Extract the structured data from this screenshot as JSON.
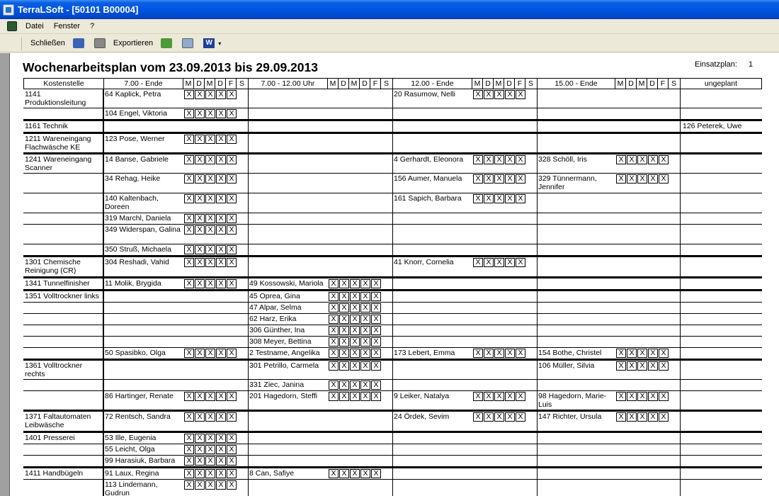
{
  "window": {
    "title": "TerraLSoft - [50101 B00004]"
  },
  "menu": {
    "items": [
      "Datei",
      "Fenster",
      "?"
    ]
  },
  "toolbar": {
    "close_label": "Schließen",
    "export_label": "Exportieren",
    "word_glyph": "W"
  },
  "report": {
    "title": "Wochenarbeitsplan vom 23.09.2013 bis 29.09.2013",
    "einsatz_label": "Einsatzplan:",
    "einsatz_value": "1",
    "headers": {
      "kostenstelle": "Kostenstelle",
      "shift1": "7.00 - Ende",
      "shift2": "7.00 - 12.00 Uhr",
      "shift3": "12.00 - Ende",
      "shift4": "15.00 - Ende",
      "ungeplant": "ungeplant",
      "days": [
        "M",
        "D",
        "M",
        "D",
        "F",
        "S"
      ]
    },
    "rows": [
      {
        "k": "1141 Produktionsleitung",
        "s1": "64 Kaplick, Petra",
        "d1": 5,
        "s2": "",
        "d2": 0,
        "s3": "20 Rasumow, Nelli",
        "d3": 5,
        "s4": "",
        "d4": 0,
        "u": "",
        "h": 26,
        "end": false
      },
      {
        "k": "",
        "s1": "104 Engel, Viktoria",
        "d1": 5,
        "s2": "",
        "d2": 0,
        "s3": "",
        "d3": 0,
        "s4": "",
        "d4": 0,
        "u": "",
        "h": 15,
        "end": true
      },
      {
        "k": "1161 Technik",
        "s1": "",
        "d1": 0,
        "s2": "",
        "d2": 0,
        "s3": "",
        "d3": 0,
        "s4": "",
        "d4": 0,
        "u": "126 Peterek, Uwe",
        "h": 15,
        "end": true
      },
      {
        "k": "1211 Wareneingang Flachwäsche KE",
        "s1": "123 Pose, Werner",
        "d1": 5,
        "s2": "",
        "d2": 0,
        "s3": "",
        "d3": 0,
        "s4": "",
        "d4": 0,
        "u": "",
        "h": 26,
        "end": true
      },
      {
        "k": "1241 Wareneingang Scanner",
        "s1": "14 Banse, Gabriele",
        "d1": 5,
        "s2": "",
        "d2": 0,
        "s3": "4 Gerhardt, Eleonora",
        "d3": 5,
        "s4": "328 Schöll, Iris",
        "d4": 5,
        "u": "",
        "h": 26,
        "end": false
      },
      {
        "k": "",
        "s1": "34 Rehag, Heike",
        "d1": 5,
        "s2": "",
        "d2": 0,
        "s3": "156 Aumer, Manuela",
        "d3": 5,
        "s4": "329 Tünnermann, Jennifer",
        "d4": 5,
        "u": "",
        "h": 27,
        "end": false
      },
      {
        "k": "",
        "s1": "140 Kaltenbach, Doreen",
        "d1": 5,
        "s2": "",
        "d2": 0,
        "s3": "161 Sapich, Barbara",
        "d3": 5,
        "s4": "",
        "d4": 0,
        "u": "",
        "h": 27,
        "end": false
      },
      {
        "k": "",
        "s1": "319 Marchl, Daniela",
        "d1": 5,
        "s2": "",
        "d2": 0,
        "s3": "",
        "d3": 0,
        "s4": "",
        "d4": 0,
        "u": "",
        "h": 15,
        "end": false
      },
      {
        "k": "",
        "s1": "349 Widerspan, Galina",
        "d1": 5,
        "s2": "",
        "d2": 0,
        "s3": "",
        "d3": 0,
        "s4": "",
        "d4": 0,
        "u": "",
        "h": 27,
        "end": false
      },
      {
        "k": "",
        "s1": "350 Struß, Michaela",
        "d1": 5,
        "s2": "",
        "d2": 0,
        "s3": "",
        "d3": 0,
        "s4": "",
        "d4": 0,
        "u": "",
        "h": 15,
        "end": true
      },
      {
        "k": "1301 Chemische Reinigung (CR)",
        "s1": "304 Reshadi, Vahid",
        "d1": 5,
        "s2": "",
        "d2": 0,
        "s3": "41 Knorr, Cornelia",
        "d3": 5,
        "s4": "",
        "d4": 0,
        "u": "",
        "h": 27,
        "end": true
      },
      {
        "k": "1341 Tunnelfinisher",
        "s1": "11 Molik, Brygida",
        "d1": 5,
        "s2": "49 Kossowski, Mariola",
        "d2": 5,
        "s3": "",
        "d3": 0,
        "s4": "",
        "d4": 0,
        "u": "",
        "h": 15,
        "end": true
      },
      {
        "k": "1351 Volltrockner links",
        "s1": "",
        "d1": 0,
        "s2": "45 Oprea, Gina",
        "d2": 5,
        "s3": "",
        "d3": 0,
        "s4": "",
        "d4": 0,
        "u": "",
        "h": 15,
        "end": false
      },
      {
        "k": "",
        "s1": "",
        "d1": 0,
        "s2": "47 Alpar, Selma",
        "d2": 5,
        "s3": "",
        "d3": 0,
        "s4": "",
        "d4": 0,
        "u": "",
        "h": 15,
        "end": false
      },
      {
        "k": "",
        "s1": "",
        "d1": 0,
        "s2": "62 Harz, Erika",
        "d2": 5,
        "s3": "",
        "d3": 0,
        "s4": "",
        "d4": 0,
        "u": "",
        "h": 15,
        "end": false
      },
      {
        "k": "",
        "s1": "",
        "d1": 0,
        "s2": "306 Günther, Ina",
        "d2": 5,
        "s3": "",
        "d3": 0,
        "s4": "",
        "d4": 0,
        "u": "",
        "h": 15,
        "end": false
      },
      {
        "k": "",
        "s1": "",
        "d1": 0,
        "s2": "308 Meyer, Bettina",
        "d2": 5,
        "s3": "",
        "d3": 0,
        "s4": "",
        "d4": 0,
        "u": "",
        "h": 15,
        "end": false
      },
      {
        "k": "",
        "s1": "50 Spasibko, Olga",
        "d1": 5,
        "s2": "2 Testname, Angelika",
        "d2": 5,
        "s3": "173 Lebert, Emma",
        "d3": 5,
        "s4": "154 Bothe, Christel",
        "d4": 5,
        "u": "",
        "h": 15,
        "end": true
      },
      {
        "k": "1361 Volltrockner rechts",
        "s1": "",
        "d1": 0,
        "s2": "301 Petrillo, Carmela",
        "d2": 5,
        "s3": "",
        "d3": 0,
        "s4": "106 Müller, Silvia",
        "d4": 5,
        "u": "",
        "h": 26,
        "end": false
      },
      {
        "k": "",
        "s1": "",
        "d1": 0,
        "s2": "331 Ziec, Janina",
        "d2": 5,
        "s3": "",
        "d3": 0,
        "s4": "",
        "d4": 0,
        "u": "",
        "h": 15,
        "end": false
      },
      {
        "k": "",
        "s1": "86 Hartinger, Renate",
        "d1": 5,
        "s2": "201 Hagedorn, Steffi",
        "d2": 5,
        "s3": "9 Leiker, Natalya",
        "d3": 5,
        "s4": "98 Hagedorn, Marie-Luis",
        "d4": 5,
        "u": "",
        "h": 26,
        "end": true
      },
      {
        "k": "1371 Faltautomaten Leibwäsche",
        "s1": "72 Rentsch, Sandra",
        "d1": 5,
        "s2": "",
        "d2": 0,
        "s3": "24 Ördek, Sevim",
        "d3": 5,
        "s4": "147 Richter, Ursula",
        "d4": 5,
        "u": "",
        "h": 27,
        "end": true
      },
      {
        "k": "1401 Presserei",
        "s1": "53 Ille, Eugenia",
        "d1": 5,
        "s2": "",
        "d2": 0,
        "s3": "",
        "d3": 0,
        "s4": "",
        "d4": 0,
        "u": "",
        "h": 15,
        "end": false
      },
      {
        "k": "",
        "s1": "55 Leicht, Olga",
        "d1": 5,
        "s2": "",
        "d2": 0,
        "s3": "",
        "d3": 0,
        "s4": "",
        "d4": 0,
        "u": "",
        "h": 15,
        "end": false
      },
      {
        "k": "",
        "s1": "99 Harasiuk, Barbara",
        "d1": 5,
        "s2": "",
        "d2": 0,
        "s3": "",
        "d3": 0,
        "s4": "",
        "d4": 0,
        "u": "",
        "h": 15,
        "end": true
      },
      {
        "k": "1411 Handbügeln",
        "s1": "91 Laux, Regina",
        "d1": 5,
        "s2": "8 Can, Safiye",
        "d2": 5,
        "s3": "",
        "d3": 0,
        "s4": "",
        "d4": 0,
        "u": "",
        "h": 15,
        "end": false
      },
      {
        "k": "",
        "s1": "113 Lindemann, Gudrun",
        "d1": 5,
        "s2": "",
        "d2": 0,
        "s3": "",
        "d3": 0,
        "s4": "",
        "d4": 0,
        "u": "",
        "h": 27,
        "end": false
      }
    ]
  }
}
